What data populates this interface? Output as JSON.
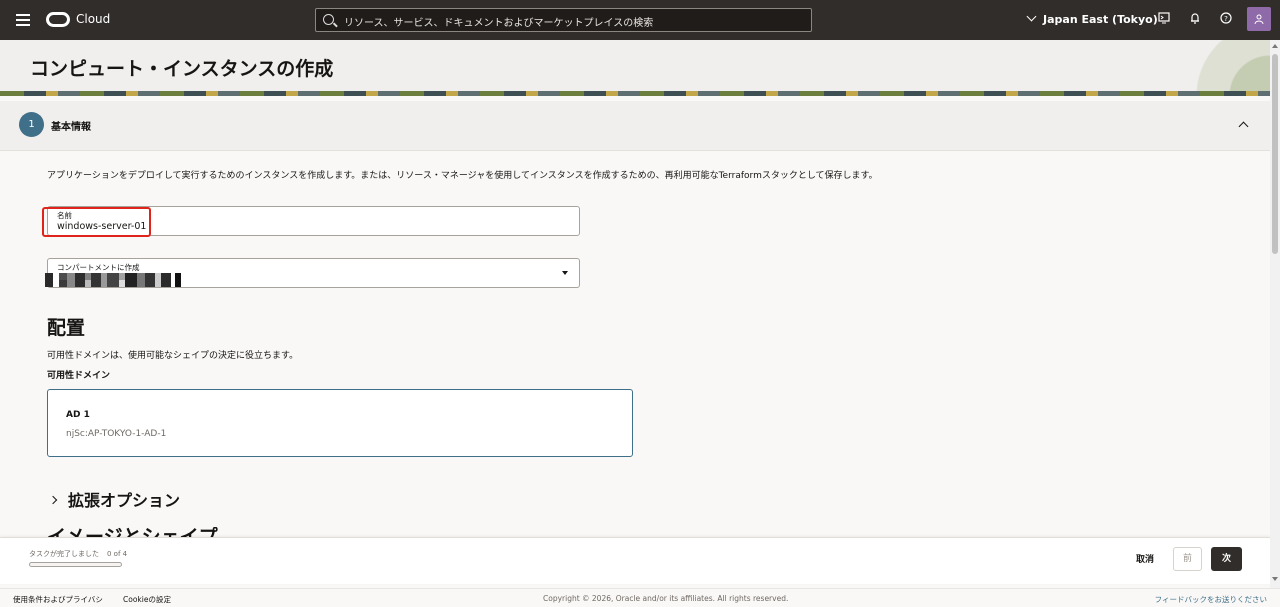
{
  "header": {
    "brand": "Cloud",
    "search_placeholder": "リソース、サービス、ドキュメントおよびマーケットプレイスの検索",
    "region": "Japan East (Tokyo)"
  },
  "page": {
    "title": "コンピュート・インスタンスの作成"
  },
  "step": {
    "number": "1",
    "label": "基本情報"
  },
  "form": {
    "description": "アプリケーションをデプロイして実行するためのインスタンスを作成します。または、リソース・マネージャを使用してインスタンスを作成するための、再利用可能なTerraformスタックとして保存します。",
    "name_label": "名前",
    "name_value": "windows-server-01",
    "compartment_label": "コンパートメントに作成"
  },
  "placement": {
    "title": "配置",
    "description": "可用性ドメインは、使用可能なシェイプの決定に役立ちます。",
    "ad_label": "可用性ドメイン",
    "ad_name": "AD 1",
    "ad_id": "njSc:AP-TOKYO-1-AD-1"
  },
  "advanced": {
    "label": "拡張オプション"
  },
  "next_section_partial": "イメージとシェイプ",
  "actionbar": {
    "progress_label": "タスクが完了しました",
    "progress_count": "0 of 4",
    "progress_fraction": 0,
    "cancel_label": "取消",
    "prev_label": "前",
    "next_label": "次"
  },
  "footer": {
    "terms": "使用条件およびプライバシ",
    "cookie": "Cookieの設定",
    "copyright": "Copyright © 2026, Oracle and/or its affiliates. All rights reserved.",
    "feedback": "フィードバックをお送りください"
  },
  "colors": {
    "header_bg": "#312d2a",
    "accent": "#3f6f89",
    "highlight": "#e0241b"
  }
}
